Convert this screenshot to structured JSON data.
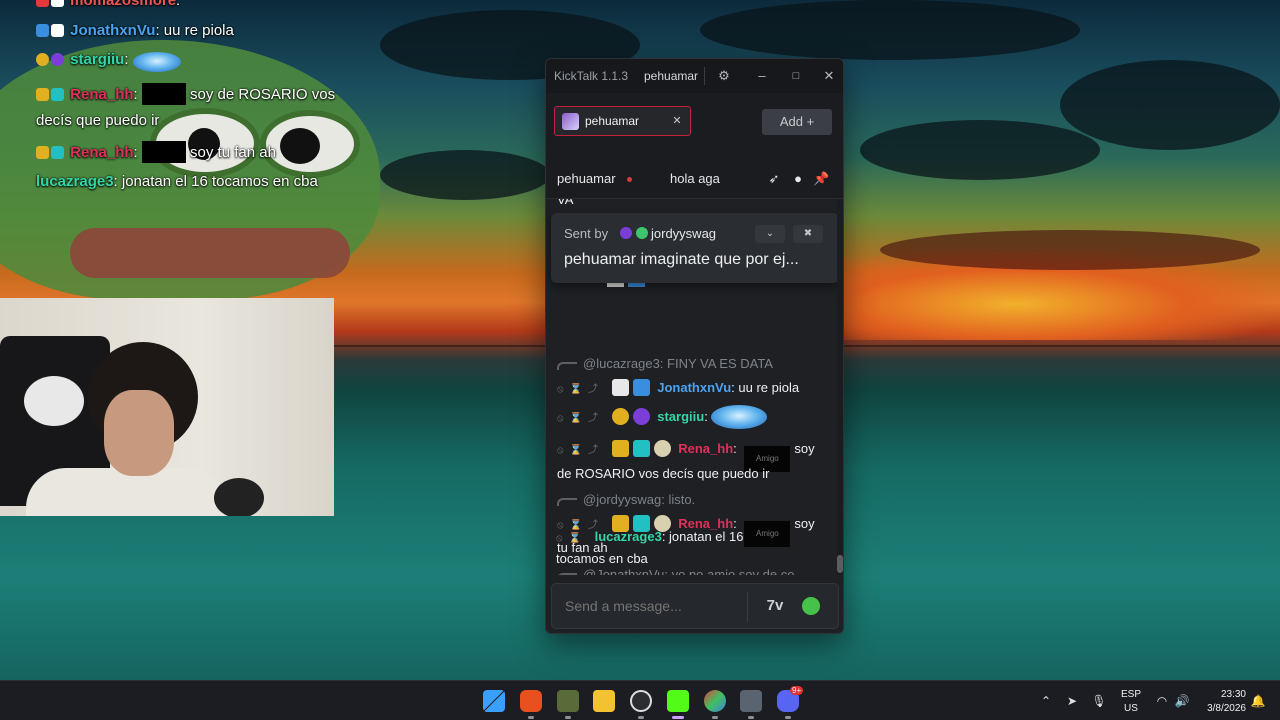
{
  "overlay_chat": {
    "lines": [
      {
        "user": "momazosmore",
        "text": ":"
      },
      {
        "user": "JonathxnVu",
        "text": ": uu re piola"
      },
      {
        "user": "stargiiu",
        "text": ":"
      },
      {
        "user": "Rena_hh",
        "text": ":",
        "tail": "soy de ROSARIO vos",
        "wrap": "decís que puedo ir"
      },
      {
        "user": "Rena_hh",
        "text": ":",
        "tail": "soy tu fan ah"
      },
      {
        "user": "lucazrage3",
        "text": ": jonatan el 16 tocamos en cba"
      }
    ]
  },
  "window": {
    "app_title": "KickTalk 1.1.3",
    "title_user": "pehuamar",
    "settings_icon": "gear-icon",
    "minimize": "–",
    "maximize": "□",
    "close": "✕"
  },
  "tabs": [
    {
      "label": "pehuamar",
      "close": "✕"
    }
  ],
  "add_button": "Add  +",
  "chat_header": {
    "streamer": "pehuamar",
    "stream_title": "hola aga"
  },
  "pinned": {
    "sent_by": "Sent by",
    "user": "jordyyswag",
    "message": "pehuamar imaginate que por ej..."
  },
  "messages": [
    {
      "type": "reply",
      "text": "@lucazrage3: FINY VA ES DATA"
    },
    {
      "type": "msg",
      "user": "JonathxnVu",
      "text": ": uu re piola"
    },
    {
      "type": "msg",
      "user": "stargiiu",
      "text": ":"
    },
    {
      "type": "msg",
      "user": "Rena_hh",
      "text": ":",
      "redact": "Amigo",
      "tail": "soy",
      "wrap": "de ROSARIO vos decís que puedo ir"
    },
    {
      "type": "reply",
      "text": "@jordyyswag: listo."
    },
    {
      "type": "msg",
      "user": "Rena_hh",
      "text": ":",
      "redact": "Amigo",
      "tail": "soy",
      "wrap": "tu fan ah"
    },
    {
      "type": "reply",
      "text": "@JonathxnVu: yo no amio soy de co..."
    },
    {
      "type": "msg",
      "user": "lucazrage3",
      "text": ": jonatan el 16",
      "wrap": "tocamos en cba"
    }
  ],
  "top_fragment": "VA",
  "input": {
    "placeholder": "Send a message...",
    "emote_7tv": "7v"
  },
  "taskbar": {
    "lang_top": "ESP",
    "lang_bottom": "US",
    "time": "23:30",
    "date": "3/8/2026",
    "notification_count": "9+"
  }
}
